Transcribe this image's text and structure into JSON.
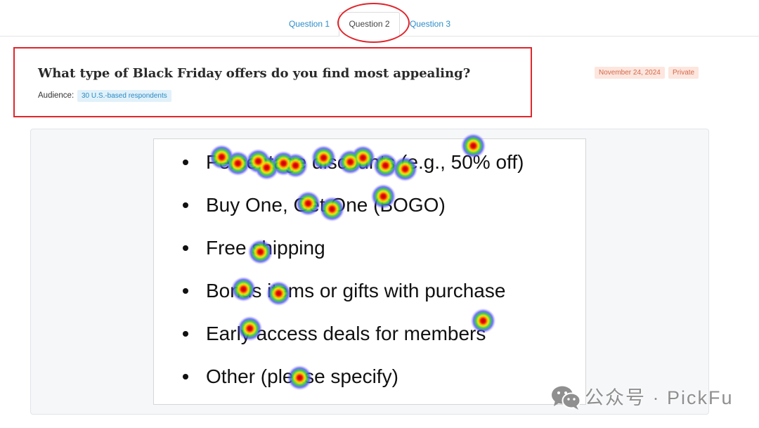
{
  "tabs": [
    {
      "label": "Question 1",
      "active": false
    },
    {
      "label": "Question 2",
      "active": true
    },
    {
      "label": "Question 3",
      "active": false
    }
  ],
  "question": {
    "title": "What type of Black Friday offers do you find most appealing?",
    "audience_label": "Audience:",
    "audience": "30 U.S.-based respondents"
  },
  "meta": {
    "date": "November 24, 2024",
    "visibility": "Private"
  },
  "options": [
    "Percentage discounts (e.g., 50% off)",
    "Buy One, Get One (BOGO)",
    "Free shipping",
    "Bonus items or gifts with purchase",
    "Early access deals for members",
    "Other (please specify)"
  ],
  "watermark": {
    "text": "公众号 · PickFu",
    "icon": "wechat-icon"
  },
  "colors": {
    "link": "#2b8dcb",
    "annotation": "#e0262d",
    "audience_badge_bg": "#e1f1fa",
    "audience_badge_text": "#2a89c2",
    "meta_badge_bg": "#fde6de",
    "meta_badge_text": "#d2694a"
  }
}
